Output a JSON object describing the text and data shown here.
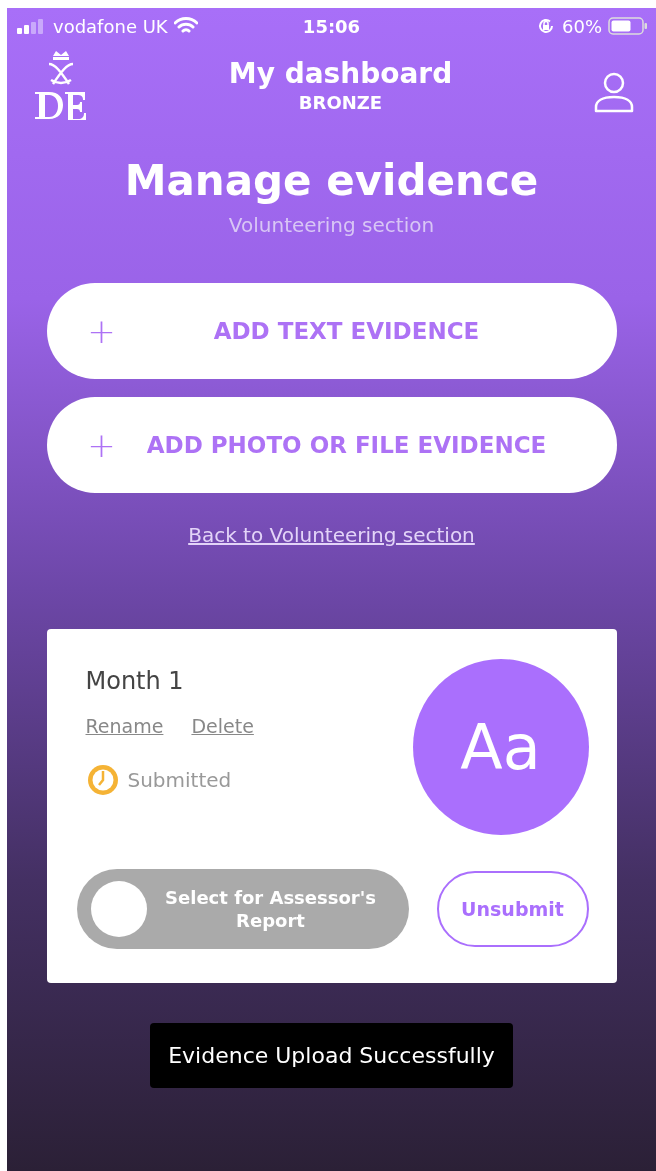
{
  "status_bar": {
    "carrier": "vodafone UK",
    "time": "15:06",
    "battery": "60%"
  },
  "header": {
    "title": "My dashboard",
    "subtitle": "BRONZE"
  },
  "page": {
    "title": "Manage evidence",
    "subtitle": "Volunteering section"
  },
  "actions": [
    {
      "icon": "+",
      "label": "ADD TEXT EVIDENCE"
    },
    {
      "icon": "+",
      "label": "ADD PHOTO OR FILE EVIDENCE"
    }
  ],
  "back_link": "Back to Volunteering section",
  "evidence": {
    "title": "Month 1",
    "links": [
      "Rename",
      "Delete"
    ],
    "status": "Submitted",
    "thumbnail": "Aa",
    "toggle": {
      "label": "Select for Assessor's Report",
      "on": false
    },
    "button": "Unsubmit"
  },
  "toast": "Evidence Upload Successfully"
}
